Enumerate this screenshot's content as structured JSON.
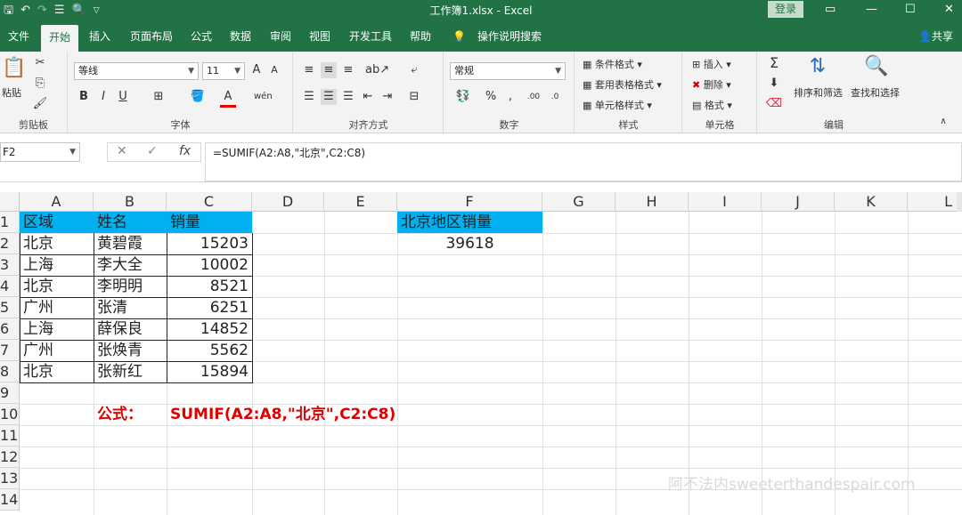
{
  "titlebar": {
    "title": "工作簿1.xlsx  -  Excel",
    "login": "登录",
    "icons": {
      "save": "save-icon",
      "undo": "undo-icon",
      "redo": "redo-icon",
      "touch": "touch-mode-icon",
      "preview": "print-preview-icon",
      "customize": "customize-qat-icon"
    }
  },
  "tabs": [
    "文件",
    "开始",
    "插入",
    "页面布局",
    "公式",
    "数据",
    "审阅",
    "视图",
    "开发工具",
    "帮助"
  ],
  "tell_me": "操作说明搜索",
  "share": "共享",
  "ribbon": {
    "clipboard": {
      "label": "剪贴板",
      "paste": "粘贴"
    },
    "font": {
      "label": "字体",
      "name": "等线",
      "size": "11",
      "bold": "B",
      "italic": "I",
      "underline": "U",
      "grow": "A",
      "shrink": "A",
      "color_a": "A"
    },
    "alignment": {
      "label": "对齐方式"
    },
    "number": {
      "label": "数字",
      "format": "常规",
      "percent": "%",
      "comma": ","
    },
    "styles": {
      "label": "样式",
      "conditional": "条件格式",
      "table": "套用表格格式",
      "cell": "单元格样式"
    },
    "cells": {
      "label": "单元格",
      "insert": "插入",
      "delete": "删除",
      "format": "格式"
    },
    "editing": {
      "label": "编辑",
      "sort": "排序和筛选",
      "find": "查找和选择",
      "sum": "Σ"
    }
  },
  "formula_bar": {
    "namebox": "F2",
    "formula": "=SUMIF(A2:A8,\"北京\",C2:C8)",
    "cancel": "✕",
    "enter": "✓",
    "fx": "fx"
  },
  "columns": [
    "A",
    "B",
    "C",
    "D",
    "E",
    "F",
    "G",
    "H",
    "I",
    "J",
    "K",
    "L"
  ],
  "rows": [
    "1",
    "2",
    "3",
    "4",
    "5",
    "6",
    "7",
    "8",
    "9",
    "10",
    "11",
    "12",
    "13",
    "14"
  ],
  "table": {
    "headers": [
      "区域",
      "姓名",
      "销量"
    ],
    "rows": [
      [
        "北京",
        "黄碧霞",
        "15203"
      ],
      [
        "上海",
        "李大全",
        "10002"
      ],
      [
        "北京",
        "李明明",
        "8521"
      ],
      [
        "广州",
        "张清",
        "6251"
      ],
      [
        "上海",
        "薛保良",
        "14852"
      ],
      [
        "广州",
        "张焕青",
        "5562"
      ],
      [
        "北京",
        "张新红",
        "15894"
      ]
    ]
  },
  "result": {
    "header": "北京地区销量",
    "value": "39618"
  },
  "note": {
    "label": "公式：",
    "formula": "SUMIF(A2:A8,\"北京\",C2:C8)"
  },
  "watermark": "阿不法内sweeterthandespair.com",
  "colors": {
    "accent": "#217346",
    "header_fill": "#00b0f0",
    "formula_red": "#e00000"
  }
}
